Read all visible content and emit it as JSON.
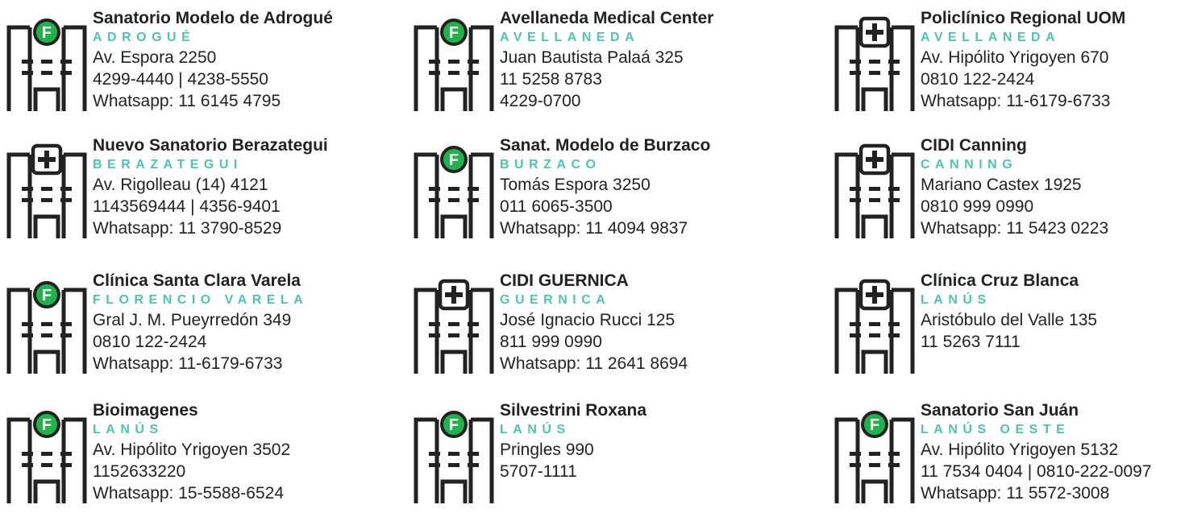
{
  "colors": {
    "accent_teal": "#4cc4b2",
    "badge_green": "#22b24c",
    "icon_stroke": "#222222"
  },
  "clinics": [
    {
      "icon": "hospital-f-icon",
      "name": "Sanatorio Modelo de Adrogué",
      "city": "ADROGUÉ",
      "lines": [
        "Av. Espora 2250",
        "4299-4440 | 4238-5550",
        "Whatsapp: 11 6145 4795"
      ]
    },
    {
      "icon": "hospital-f-icon",
      "name": "Avellaneda Medical Center",
      "city": "AVELLANEDA",
      "lines": [
        "Juan Bautista Palaá 325",
        "11 5258 8783",
        "4229-0700"
      ]
    },
    {
      "icon": "hospital-cross-icon",
      "name": "Policlínico Regional UOM",
      "city": "AVELLANEDA",
      "lines": [
        "Av. Hipólito Yrigoyen 670",
        "0810 122-2424",
        "Whatsapp: 11-6179-6733"
      ]
    },
    {
      "icon": "hospital-cross-icon",
      "name": "Nuevo Sanatorio Berazategui",
      "city": "BERAZATEGUI",
      "lines": [
        "Av. Rigolleau (14) 4121",
        "1143569444 | 4356-9401",
        "Whatsapp: 11 3790-8529"
      ]
    },
    {
      "icon": "hospital-f-icon",
      "name": "Sanat. Modelo de Burzaco",
      "city": "BURZACO",
      "lines": [
        "Tomás Espora 3250",
        "011 6065-3500",
        "Whatsapp: 11 4094 9837"
      ]
    },
    {
      "icon": "hospital-cross-icon",
      "name": "CIDI Canning",
      "city": "CANNING",
      "lines": [
        "Mariano Castex 1925",
        "0810 999 0990",
        "Whatsapp: 11 5423 0223"
      ]
    },
    {
      "icon": "hospital-f-icon",
      "name": "Clínica Santa Clara Varela",
      "city": "FLORENCIO VARELA",
      "lines": [
        "Gral J. M. Pueyrredón 349",
        "0810 122-2424",
        "Whatsapp: 11-6179-6733"
      ]
    },
    {
      "icon": "hospital-cross-icon",
      "name": "CIDI GUERNICA",
      "city": "GUERNICA",
      "lines": [
        "José Ignacio Rucci 125",
        "811 999 0990",
        "Whatsapp: 11 2641 8694"
      ]
    },
    {
      "icon": "hospital-cross-icon",
      "name": "Clínica Cruz Blanca",
      "city": "LANÚS",
      "lines": [
        "Aristóbulo del Valle 135",
        "11 5263 7111"
      ]
    },
    {
      "icon": "hospital-f-icon",
      "name": "Bioimagenes",
      "city": "LANÚS",
      "lines": [
        "Av. Hipólito Yrigoyen 3502",
        "1152633220",
        "Whatsapp: 15-5588-6524"
      ]
    },
    {
      "icon": "hospital-f-icon",
      "name": "Silvestrini Roxana",
      "city": "LANÚS",
      "lines": [
        "Pringles 990",
        "5707-1111"
      ]
    },
    {
      "icon": "hospital-f-icon",
      "name": "Sanatorio San Juán",
      "city": "LANÚS OESTE",
      "lines": [
        "Av. Hipólito Yrigoyen 5132",
        "11 7534 0404 | 0810-222-0097",
        "Whatsapp: 11 5572-3008"
      ]
    }
  ]
}
